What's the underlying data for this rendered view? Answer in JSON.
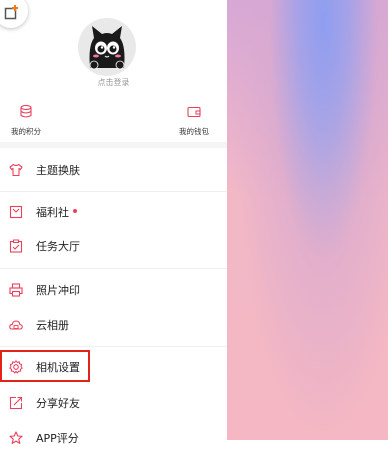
{
  "header": {
    "login_text": "点击登录"
  },
  "quick_actions": [
    {
      "label": "我的积分",
      "icon": "database-icon"
    },
    {
      "label": "我的钱包",
      "icon": "wallet-icon"
    }
  ],
  "menu": {
    "theme": "主题换肤",
    "welfare": "福利社",
    "tasks": "任务大厅",
    "photo_print": "照片冲印",
    "cloud_album": "云相册",
    "camera_settings": "相机设置",
    "share": "分享好友",
    "rate_app": "APP评分"
  },
  "colors": {
    "accent": "#e8405e",
    "highlight_border": "#e2231a"
  }
}
